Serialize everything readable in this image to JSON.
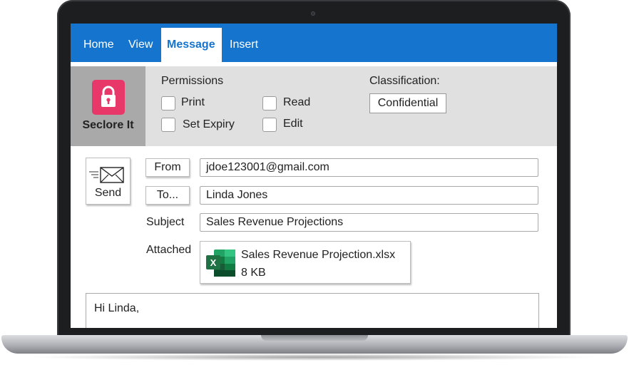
{
  "ribbon_tabs": [
    {
      "label": "Home",
      "active": false
    },
    {
      "label": "View",
      "active": false
    },
    {
      "label": "Message",
      "active": true
    },
    {
      "label": "Insert",
      "active": false
    }
  ],
  "seclore": {
    "label": "Seclore It",
    "icon": "lock-icon",
    "icon_color": "#e8386a"
  },
  "permissions": {
    "title": "Permissions",
    "options": [
      {
        "label": "Print",
        "checked": false
      },
      {
        "label": "Set Expiry",
        "checked": false
      },
      {
        "label": "Read",
        "checked": false
      },
      {
        "label": "Edit",
        "checked": false
      }
    ]
  },
  "classification": {
    "title": "Classification:",
    "value": "Confidential"
  },
  "compose": {
    "send_label": "Send",
    "from_button": "From",
    "from_value": "jdoe123001@gmail.com",
    "to_button": "To...",
    "to_value": "Linda Jones",
    "subject_label": "Subject",
    "subject_value": "Sales Revenue Projections",
    "attached_label": "Attached",
    "attachment": {
      "name": "Sales Revenue Projection.xlsx",
      "size": "8 KB",
      "icon": "excel-icon"
    },
    "body_text": "Hi Linda,"
  },
  "colors": {
    "accent": "#1574cd",
    "seclore_red": "#e8386a",
    "excel_green": "#1f7244"
  }
}
